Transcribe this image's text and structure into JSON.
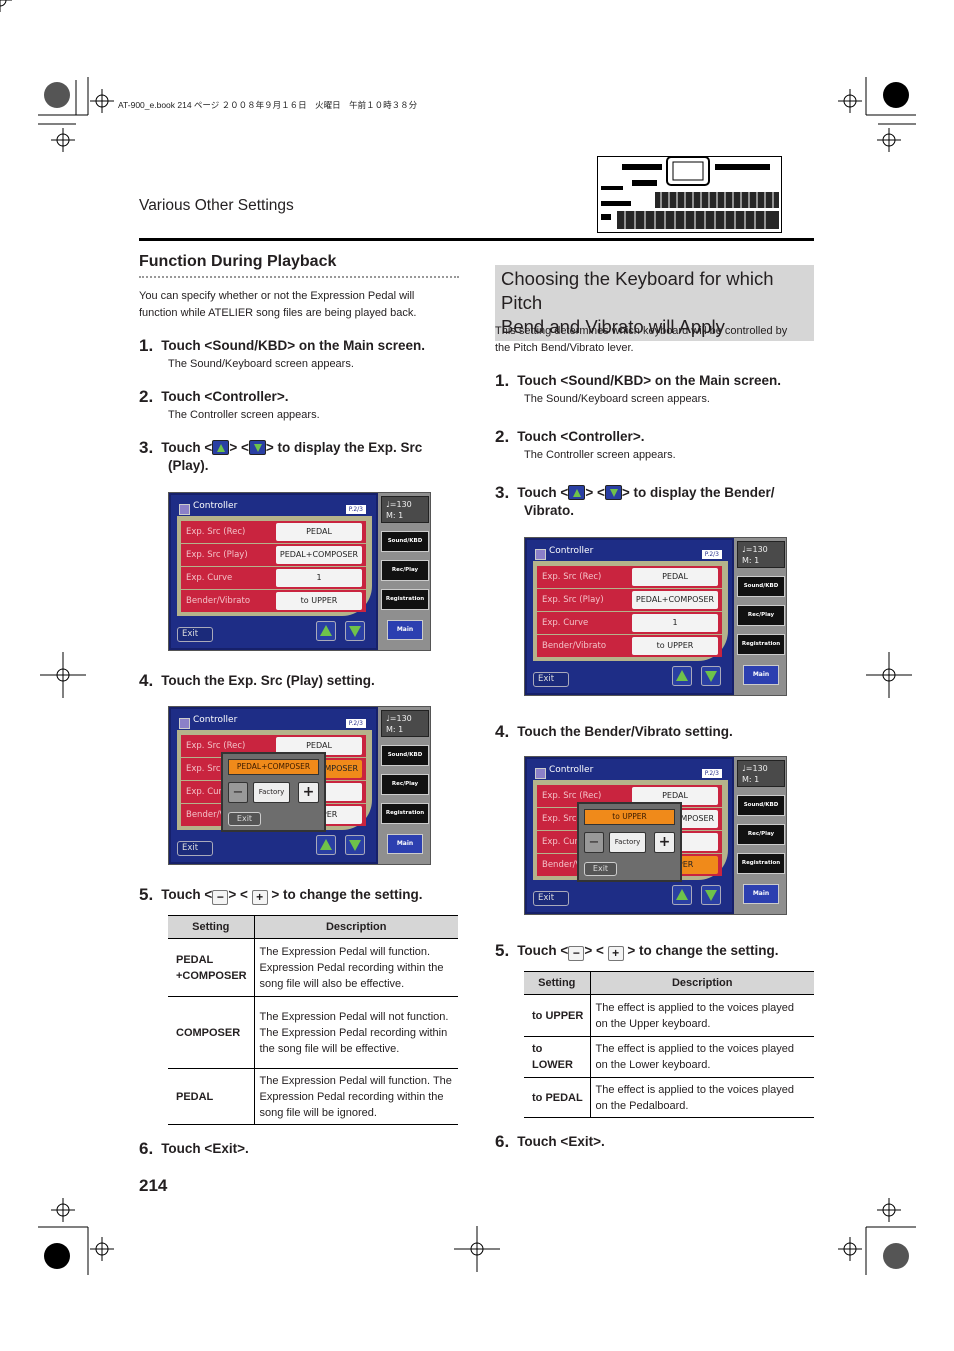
{
  "print_line": "AT-900_e.book  214 ページ  ２００８年９月１６日　火曜日　午前１０時３８分",
  "section_header": "Various Other Settings",
  "page_number": "214",
  "left": {
    "heading": "Function During Playback",
    "intro": [
      "You can specify whether or not the Expression Pedal will",
      "function while ATELIER song files are being played back."
    ],
    "steps": [
      {
        "num": "1.",
        "text": "Touch <Sound/KBD> on the Main screen.",
        "sub": "The Sound/Keyboard screen appears."
      },
      {
        "num": "2.",
        "text": "Touch <Controller>.",
        "sub": "The Controller screen appears."
      },
      {
        "num": "3.",
        "pre": "Touch <",
        "mid": "> <",
        "post": "> to display the Exp. Src",
        "line2": "(Play)."
      },
      {
        "num": "4.",
        "text": "Touch the Exp. Src (Play) setting."
      },
      {
        "num": "5.",
        "pre": "Touch <",
        "mid": "> < ",
        "post": " > to change the setting.",
        "minus": "−",
        "plus": "+"
      },
      {
        "num": "6.",
        "text": "Touch <Exit>."
      }
    ],
    "table": {
      "headers": [
        "Setting",
        "Description"
      ],
      "rows": [
        {
          "setting": [
            "PEDAL",
            "+COMPOSER"
          ],
          "desc": "The Expression Pedal will function. Expression Pedal recording within the song file will also be effective."
        },
        {
          "setting": [
            "COMPOSER"
          ],
          "desc": "The Expression Pedal will not function. The Expression Pedal recording within the song file will be effective."
        },
        {
          "setting": [
            "PEDAL"
          ],
          "desc": "The Expression Pedal will function. The Expression Pedal recording within the song file will be ignored."
        }
      ]
    }
  },
  "right": {
    "heading": [
      "Choosing the Keyboard for which Pitch",
      "Bend and Vibrato will Apply"
    ],
    "intro": [
      "This setting determines which keyboard will be controlled by",
      "the Pitch Bend/Vibrato lever."
    ],
    "steps": [
      {
        "num": "1.",
        "text": "Touch <Sound/KBD> on the Main screen.",
        "sub": "The Sound/Keyboard screen appears."
      },
      {
        "num": "2.",
        "text": "Touch <Controller>.",
        "sub": "The Controller screen appears."
      },
      {
        "num": "3.",
        "pre": "Touch <",
        "mid": "> <",
        "post": "> to display the Bender/",
        "line2": "Vibrato."
      },
      {
        "num": "4.",
        "text": "Touch the Bender/Vibrato setting."
      },
      {
        "num": "5.",
        "pre": "Touch <",
        "mid": "> < ",
        "post": " > to change the setting.",
        "minus": "−",
        "plus": "+"
      },
      {
        "num": "6.",
        "text": "Touch <Exit>."
      }
    ],
    "table": {
      "headers": [
        "Setting",
        "Description"
      ],
      "rows": [
        {
          "setting": [
            "to UPPER"
          ],
          "desc": "The effect is applied to the voices played on the Upper keyboard."
        },
        {
          "setting": [
            "to LOWER"
          ],
          "desc": "The effect is applied to the voices played on the Lower keyboard."
        },
        {
          "setting": [
            "to PEDAL"
          ],
          "desc": "The effect is applied to the voices played on the Pedalboard."
        }
      ]
    }
  },
  "screen": {
    "title": "Controller",
    "page": "P.2/3",
    "tempo": "♩=130",
    "measure": "M:   1",
    "labels": [
      "Exp. Src (Rec)",
      "Exp. Src (Play)",
      "Exp. Curve",
      "Bender/Vibrato"
    ],
    "values": [
      "PEDAL",
      "PEDAL+COMPOSER",
      "1",
      "to UPPER"
    ],
    "exit": "Exit",
    "side_buttons": [
      "Sound/KBD",
      "Rec/Play",
      "Registration"
    ],
    "main": "Main",
    "factory": "Factory",
    "minus": "−",
    "plus": "+"
  },
  "screens": [
    {
      "highlight": null
    },
    {
      "highlight": 1,
      "popup_value": "PEDAL+COMPOSER"
    },
    {
      "highlight": null
    },
    {
      "highlight": 3,
      "popup_value": "to UPPER"
    }
  ]
}
